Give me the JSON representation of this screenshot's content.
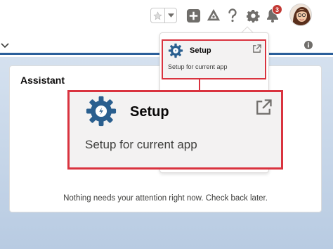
{
  "header": {
    "favorites_star_icon": "star-icon",
    "favorites_dropdown_icon": "caret-down-icon",
    "global_actions_icon": "plus-icon",
    "trailhead_icon": "trailhead-icon",
    "help_icon": "question-icon",
    "setup_icon": "gear-icon",
    "notifications_icon": "bell-icon",
    "notifications_count": "3"
  },
  "assistant": {
    "title": "Assistant",
    "empty_message": "Nothing needs your attention right now. Check back later."
  },
  "setup_menu": {
    "item_title": "Setup",
    "item_subtitle": "Setup for current app",
    "external_icon": "external-link-icon"
  },
  "colors": {
    "brand_blue": "#2a5f9b",
    "highlight_red": "#d9333f",
    "badge_red": "#c23934",
    "gear_blue": "#2a5f8f"
  }
}
